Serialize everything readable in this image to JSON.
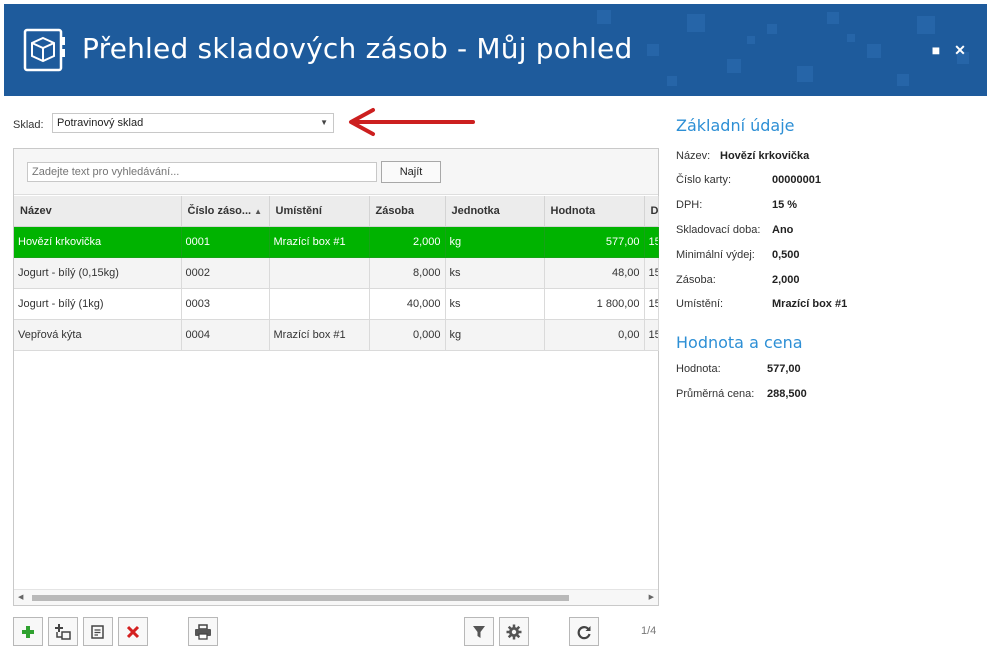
{
  "window": {
    "title": "Přehled skladových zásob - Můj pohled",
    "maximize_icon": "■",
    "close_icon": "✕"
  },
  "sklad": {
    "label": "Sklad:",
    "value": "Potravinový sklad"
  },
  "search": {
    "placeholder": "Zadejte text pro vyhledávání...",
    "button_label": "Najít"
  },
  "table": {
    "columns": [
      "Název",
      "Číslo záso...",
      "Umístění",
      "Zásoba",
      "Jednotka",
      "Hodnota",
      "D"
    ],
    "rows": [
      [
        "Hovězí krkovička",
        "0001",
        "Mrazící box #1",
        "2,000",
        "kg",
        "577,00",
        "15"
      ],
      [
        "Jogurt - bílý (0,15kg)",
        "0002",
        "",
        "8,000",
        "ks",
        "48,00",
        "15"
      ],
      [
        "Jogurt - bílý (1kg)",
        "0003",
        "",
        "40,000",
        "ks",
        "1 800,00",
        "15"
      ],
      [
        "Vepřová kýta",
        "0004",
        "Mrazící box #1",
        "0,000",
        "kg",
        "0,00",
        "15"
      ]
    ],
    "selected_row": 0
  },
  "pager": "1/4",
  "details": {
    "basic_title": "Základní údaje",
    "basic": [
      {
        "label": "Název:",
        "value": "Hovězí krkovička"
      },
      {
        "label": "Číslo karty:",
        "value": "00000001"
      },
      {
        "label": "DPH:",
        "value": "15 %"
      },
      {
        "label": "Skladovací doba:",
        "value": "Ano"
      },
      {
        "label": "Minimální výdej:",
        "value": "0,500"
      },
      {
        "label": "Zásoba:",
        "value": "2,000"
      },
      {
        "label": "Umístění:",
        "value": "Mrazící box #1"
      }
    ],
    "value_title": "Hodnota a cena",
    "value": [
      {
        "label": "Hodnota:",
        "value": "577,00"
      },
      {
        "label": "Průměrná cena:",
        "value": "288,500"
      }
    ]
  },
  "colors": {
    "header": "#1e5b9c",
    "selected_row": "#00b300",
    "section_title": "#2d8fd5",
    "arrow": "#cc1f1f"
  }
}
